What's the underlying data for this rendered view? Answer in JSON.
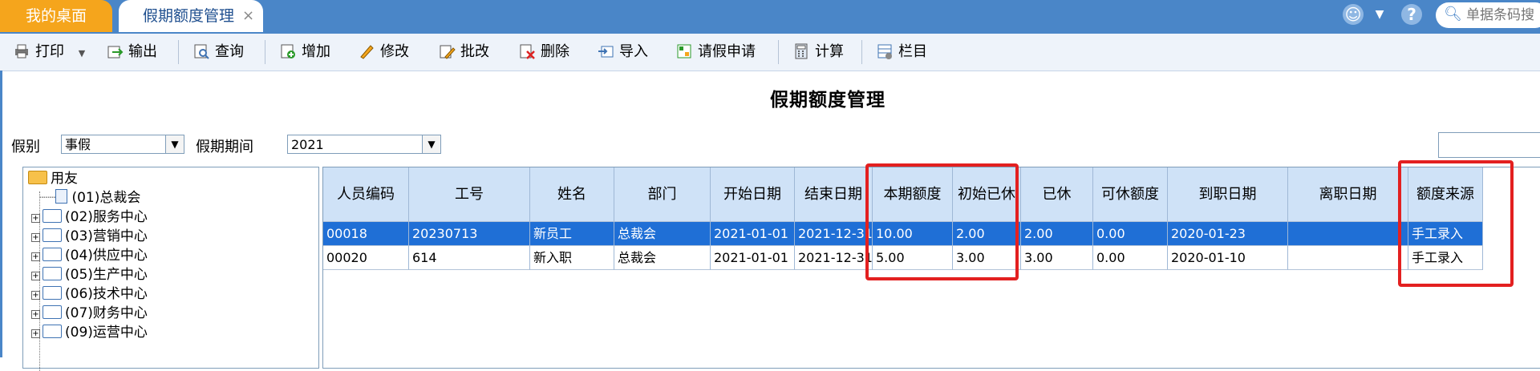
{
  "tabs": [
    {
      "label": "我的桌面"
    },
    {
      "label": "假期额度管理",
      "close": "×"
    }
  ],
  "topbar": {
    "search_placeholder": "单据条码搜",
    "icons": [
      "smiley-icon",
      "chevron-down-icon",
      "help-icon",
      "search-icon"
    ]
  },
  "toolbar": {
    "print": "打印",
    "export": "输出",
    "query": "查询",
    "add": "增加",
    "modify": "修改",
    "batch_modify": "批改",
    "delete": "删除",
    "import": "导入",
    "leave_request": "请假申请",
    "calculate": "计算",
    "columns": "栏目"
  },
  "page": {
    "title": "假期额度管理"
  },
  "filters": {
    "leave_type_label": "假别",
    "leave_type_value": "事假",
    "period_label": "假期期间",
    "period_value": "2021"
  },
  "tree": {
    "root": "用友",
    "nodes": [
      "(01)总裁会",
      "(02)服务中心",
      "(03)营销中心",
      "(04)供应中心",
      "(05)生产中心",
      "(06)技术中心",
      "(07)财务中心",
      "(09)运营中心"
    ]
  },
  "grid": {
    "columns": [
      "人员编码",
      "工号",
      "姓名",
      "部门",
      "开始日期",
      "结束日期",
      "本期额度",
      "初始已休",
      "已休",
      "可休额度",
      "到职日期",
      "离职日期",
      "额度来源"
    ],
    "rows": [
      [
        "00018",
        "20230713",
        "新员工",
        "总裁会",
        "2021-01-01",
        "2021-12-31",
        "10.00",
        "2.00",
        "2.00",
        "0.00",
        "2020-01-23",
        "",
        "手工录入"
      ],
      [
        "00020",
        "614",
        "新入职",
        "总裁会",
        "2021-01-01",
        "2021-12-31",
        "5.00",
        "3.00",
        "3.00",
        "0.00",
        "2020-01-10",
        "",
        "手工录入"
      ]
    ],
    "selected_row": 0
  },
  "colors": {
    "accent": "#4a86c8",
    "desk_tab": "#f5a51c",
    "selection": "#1f6fd6",
    "highlight": "#e32020"
  }
}
